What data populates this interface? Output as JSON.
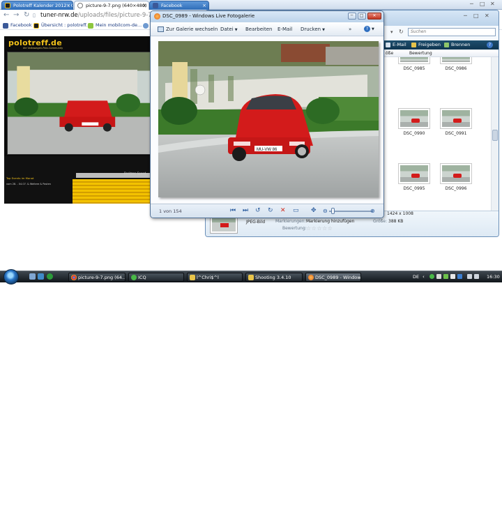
{
  "browser": {
    "tabs": [
      {
        "label": "Polotreff Kalender 2012 : C",
        "active": false
      },
      {
        "label": "picture-9-7.png (640×480)",
        "active": true
      },
      {
        "label": "Facebook",
        "active": false
      }
    ],
    "url_host": "tuner-nrw.de",
    "url_path": "/uploads/files/picture-9-7.png",
    "bookmarks": [
      {
        "label": "Facebook"
      },
      {
        "label": "Übersicht : polotreff..."
      },
      {
        "label": "Mein mobilcom-de..."
      }
    ]
  },
  "polotreff": {
    "logo": "polotreff.de",
    "subtitle": "die Volkswagen-Polo-Community",
    "link": "Top Events im Monat",
    "small": "vom 28. - 04.07. & Weitere & Posten",
    "besitzer": "Besitzer:   Speed"
  },
  "explorer": {
    "search_placeholder": "Suchen",
    "toolbar": [
      {
        "label": "E-Mail"
      },
      {
        "label": "Freigeben"
      },
      {
        "label": "Brennen"
      }
    ],
    "help": "?",
    "columns": [
      "öße",
      "Bewertung"
    ],
    "thumbnails": [
      {
        "label": "DSC_0985"
      },
      {
        "label": "DSC_0986"
      },
      {
        "label": "DSC_0990"
      },
      {
        "label": "DSC_0991"
      },
      {
        "label": "DSC_0995"
      },
      {
        "label": "DSC_0996"
      }
    ],
    "details": {
      "type": "JPEG-Bild",
      "markings_label": "Markierungen:",
      "markings_value": "Markierung hinzufügen",
      "rating_label": "Bewertung:",
      "dimensions": "1424 x 1008",
      "size_label": "Größe:",
      "size_value": "388 KB",
      "stars": "☆☆☆☆☆"
    }
  },
  "gallery": {
    "title": "DSC_0989 - Windows Live Fotogalerie",
    "toolbar": {
      "back": "Zur Galerie wechseln",
      "file": "Datei",
      "edit": "Bearbeiten",
      "email": "E-Mail",
      "print": "Drucken",
      "more": "»",
      "help": "?"
    },
    "count": "1 von 154"
  },
  "taskbar": {
    "tasks": [
      {
        "label": "picture-9-7.png (64..."
      },
      {
        "label": "ICQ"
      },
      {
        "label": "l^Chri$^l"
      },
      {
        "label": "Shooting 3.4.10"
      },
      {
        "label": "DSC_0989 - Window..."
      }
    ],
    "lang": "DE",
    "clock": "16:30"
  },
  "colors": {
    "accent_blue": "#2f6db8",
    "car_red": "#d31b1b",
    "polo_yellow": "#f2c21a",
    "explorer_toolbar": "#1f4f6e"
  }
}
